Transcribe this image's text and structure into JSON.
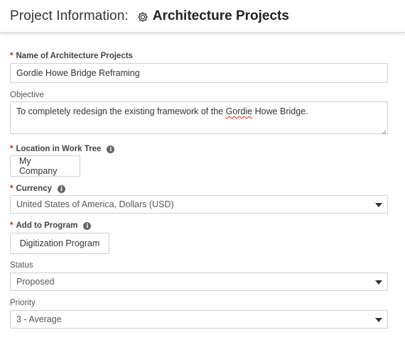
{
  "header": {
    "prefix": "Project Information:",
    "module_icon": "gear-icon",
    "module_name": "Architecture Projects"
  },
  "form": {
    "name": {
      "label": "Name of Architecture Projects",
      "required": true,
      "value": "Gordie Howe Bridge Reframing"
    },
    "objective": {
      "label": "Objective",
      "value_before": "To completely redesign the existing framework of the ",
      "value_misspelled": "Gordie",
      "value_after": " Howe Bridge."
    },
    "location": {
      "label": "Location in Work Tree",
      "required": true,
      "info_icon": "info-icon",
      "value": "My Company"
    },
    "currency": {
      "label": "Currency",
      "required": true,
      "info_icon": "info-icon",
      "value": "United States of America, Dollars (USD)"
    },
    "program": {
      "label": "Add to Program",
      "required": true,
      "info_icon": "info-icon",
      "value": "Digitization Program"
    },
    "status": {
      "label": "Status",
      "value": "Proposed"
    },
    "priority": {
      "label": "Priority",
      "value": "3 - Average"
    }
  },
  "colors": {
    "required_star": "#cc2222",
    "border": "#cfcfcf",
    "spellcheck": "#dd2222"
  }
}
